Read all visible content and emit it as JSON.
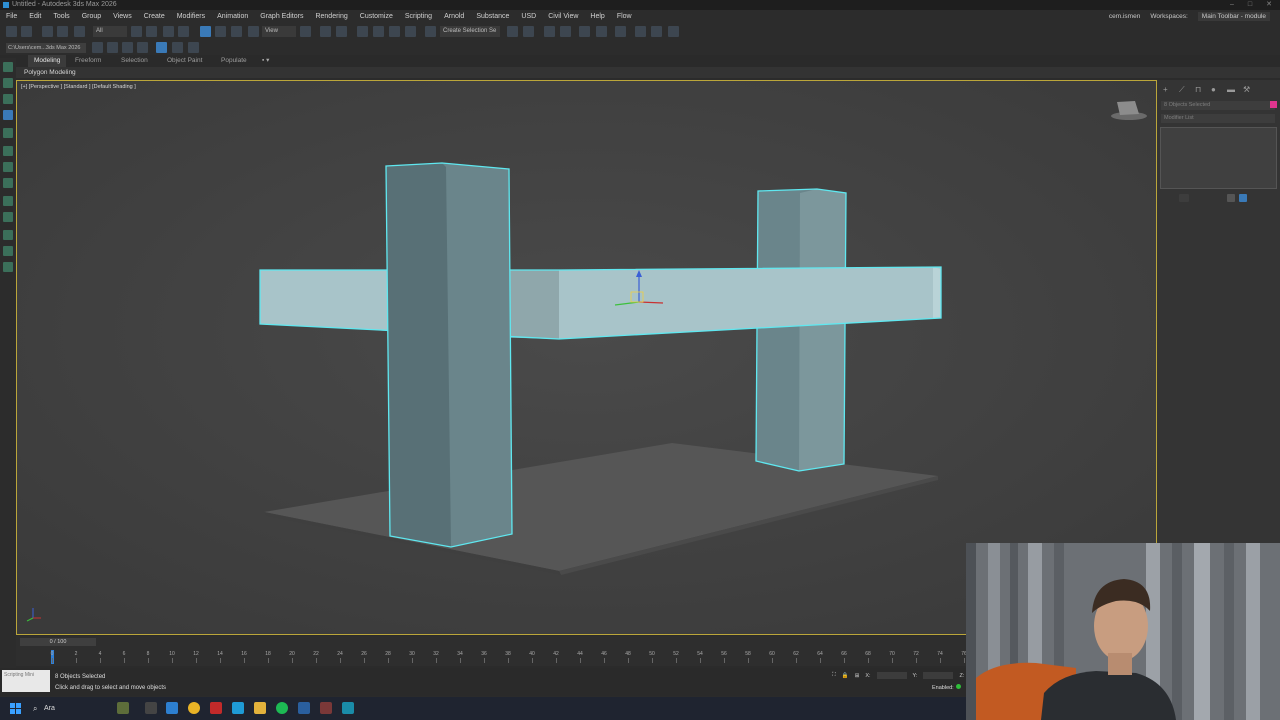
{
  "window": {
    "title": "Untitled - Autodesk 3ds Max 2026"
  },
  "menubar": {
    "items": [
      "File",
      "Edit",
      "Tools",
      "Group",
      "Views",
      "Create",
      "Modifiers",
      "Animation",
      "Graph Editors",
      "Rendering",
      "Customize",
      "Scripting",
      "Arnold",
      "Substance",
      "USD",
      "Civil View",
      "Help",
      "Flow"
    ],
    "user": "cem.ismen",
    "workspaces_label": "Workspaces:",
    "workspace_value": "Main Toolbar - module"
  },
  "toolbar": {
    "selection_filter": "All",
    "ref_coord": "View",
    "create_selection_set": "Create Selection Se"
  },
  "toolbar2": {
    "project_path": "C:\\Users\\cem...3ds Max 2026"
  },
  "ribbon": {
    "tabs": [
      "Modeling",
      "Freeform",
      "Selection",
      "Object Paint",
      "Populate"
    ],
    "active_tab": "Modeling",
    "sub_label": "Polygon Modeling"
  },
  "viewport": {
    "label": "[+] [Perspective ] [Standard ] [Default Shading ]"
  },
  "command_panel": {
    "objects_selected_field": "8 Objects Selected",
    "modifier_list": "Modifier List",
    "accent_color": "#e0358e"
  },
  "timeline": {
    "frame_display": "0 / 100",
    "current_frame": 0,
    "tick_labels": [
      "0",
      "2",
      "4",
      "6",
      "8",
      "10",
      "12",
      "14",
      "16",
      "18",
      "20",
      "22",
      "24",
      "26",
      "28",
      "30",
      "32",
      "34",
      "36",
      "38",
      "40",
      "42",
      "44",
      "46",
      "48",
      "50",
      "52",
      "54",
      "56",
      "58",
      "60",
      "62",
      "64",
      "66",
      "68",
      "70",
      "72",
      "74",
      "76"
    ]
  },
  "status": {
    "maxscript_label": "Scripting Mini",
    "selected": "8 Objects Selected",
    "prompt": "Click and drag to select and move objects",
    "x_label": "X:",
    "y_label": "Y:",
    "z_label": "Z:",
    "enabled_label": "Enabled:"
  },
  "taskbar": {
    "search_label": "Ara"
  },
  "colors": {
    "selection_outline": "#5fe8f0",
    "viewport_border": "#bba63a",
    "active_button": "#3a7ab8"
  }
}
